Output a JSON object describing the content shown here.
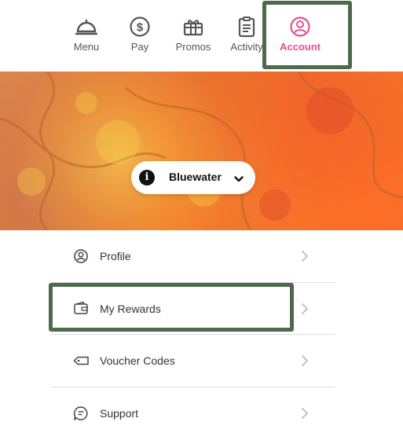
{
  "nav": {
    "items": [
      {
        "label": "Menu",
        "icon": "cloche-icon"
      },
      {
        "label": "Pay",
        "icon": "dollar-circle-icon"
      },
      {
        "label": "Promos",
        "icon": "gift-icon"
      },
      {
        "label": "Activity",
        "icon": "clipboard-icon"
      },
      {
        "label": "Account",
        "icon": "user-circle-icon"
      }
    ],
    "active": "Account",
    "active_color": "#e0518f"
  },
  "location": {
    "name": "Bluewater",
    "info_icon": "info-icon",
    "chevron_icon": "chevron-down-icon"
  },
  "account_menu": {
    "items": [
      {
        "label": "Profile",
        "icon": "user-circle-icon"
      },
      {
        "label": "My Rewards",
        "icon": "wallet-icon"
      },
      {
        "label": "Voucher Codes",
        "icon": "tag-icon"
      },
      {
        "label": "Support",
        "icon": "message-icon"
      }
    ]
  },
  "highlight_color": "#4d6b4b"
}
